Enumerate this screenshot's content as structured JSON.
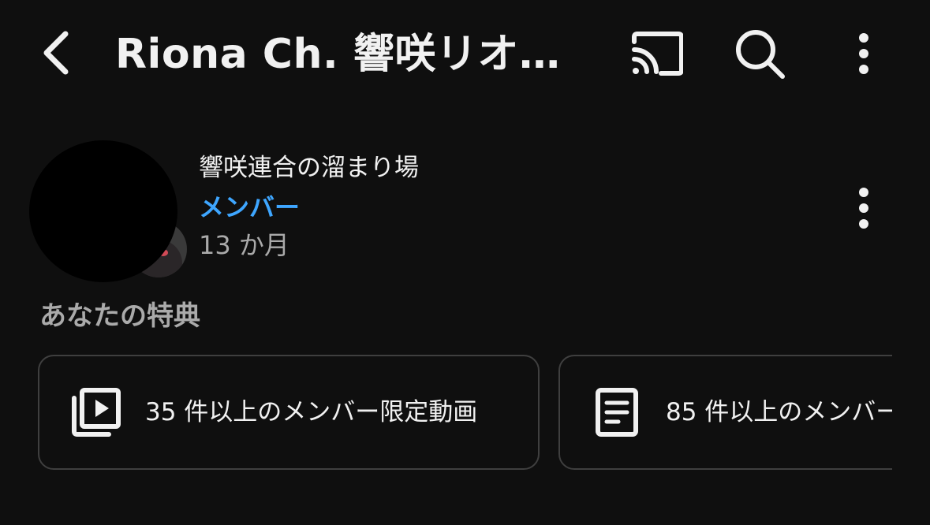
{
  "header": {
    "title": "Riona Ch. 響咲リオ…",
    "icons": {
      "back": "back-arrow-icon",
      "cast": "cast-icon",
      "search": "search-icon",
      "more": "more-vert-icon"
    }
  },
  "membership": {
    "community_name": "響咲連合の溜まり場",
    "status_label": "メンバー",
    "duration": "13 か月",
    "icons": {
      "avatar": "channel-avatar",
      "more": "more-vert-icon"
    }
  },
  "perks": {
    "heading": "あなたの特典",
    "items": [
      {
        "label": "35 件以上のメンバー限定動画",
        "icon": "video-library-icon"
      },
      {
        "label": "85 件以上のメンバー",
        "icon": "document-icon"
      }
    ]
  },
  "colors": {
    "background": "#0f0f0f",
    "text_primary": "#f1f1f1",
    "text_secondary": "#aaaaaa",
    "accent_blue": "#3ea6ff",
    "card_border": "#3f3f3f"
  }
}
